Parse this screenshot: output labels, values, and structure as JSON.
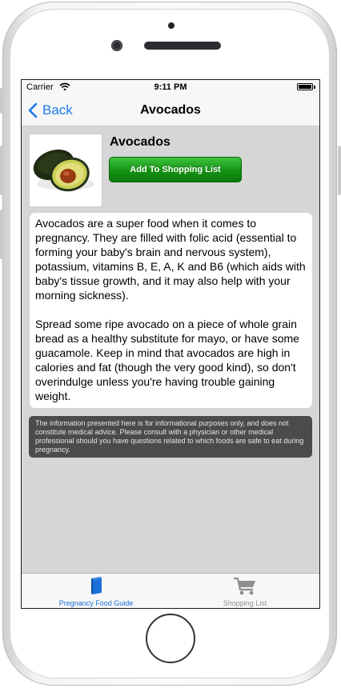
{
  "status_bar": {
    "carrier": "Carrier",
    "time": "9:11 PM"
  },
  "nav": {
    "back_label": "Back",
    "title": "Avocados"
  },
  "food": {
    "name": "Avocados",
    "add_button_label": "Add To Shopping List",
    "description": [
      "Avocados are a super food when it comes to pregnancy. They are filled with folic acid (essential to forming your baby's brain and nervous system), potassium, vitamins B, E, A, K and B6 (which aids with baby's tissue growth, and it may also help with your morning sickness).",
      "Spread some ripe avocado on a piece of whole grain bread as a healthy substitute for mayo, or have some guacamole. Keep in mind that avocados are high in calories and fat (though the very good kind), so don't overindulge unless you're having trouble gaining weight."
    ]
  },
  "disclaimer": "The information presented here is for informational purposes only, and does not constitute medical advice. Please consult with a physician or other medical professional should you have questions related to which foods are safe to eat during pregnancy.",
  "tab_bar": {
    "items": [
      {
        "label": "Pregnancy Food Guide",
        "icon": "book-icon",
        "active": true
      },
      {
        "label": "Shopping List",
        "icon": "cart-icon",
        "active": false
      }
    ]
  },
  "colors": {
    "accent": "#1a7bea",
    "add_button": "#149214",
    "disclaimer_bg": "#4b4b4b",
    "screen_bg": "#d6d6d6"
  }
}
